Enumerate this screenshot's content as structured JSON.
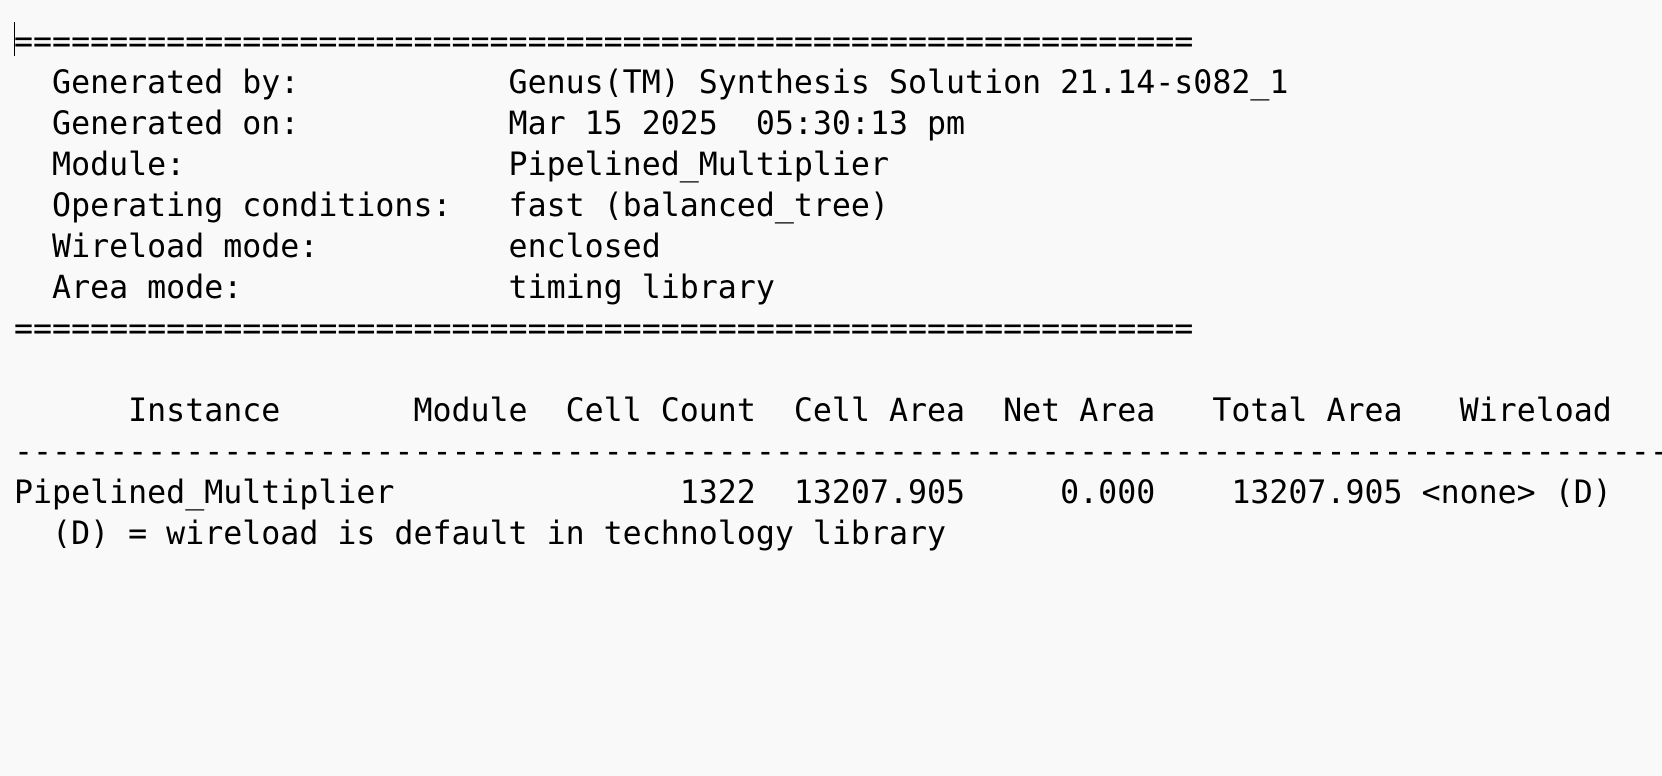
{
  "report": {
    "rule_double": "==============================================================",
    "rule_single": "------------------------------------------------------------------------------------------",
    "header": [
      {
        "label": "Generated by:",
        "value": "Genus(TM) Synthesis Solution 21.14-s082_1"
      },
      {
        "label": "Generated on:",
        "value": "Mar 15 2025  05:30:13 pm"
      },
      {
        "label": "Module:",
        "value": "Pipelined_Multiplier"
      },
      {
        "label": "Operating conditions:",
        "value": "fast (balanced_tree)"
      },
      {
        "label": "Wireload mode:",
        "value": "enclosed"
      },
      {
        "label": "Area mode:",
        "value": "timing library"
      }
    ],
    "columns": [
      "Instance",
      "Module",
      "Cell Count",
      "Cell Area",
      "Net Area",
      "Total Area",
      "Wireload"
    ],
    "rows": [
      {
        "instance": "Pipelined_Multiplier",
        "module": "",
        "cell_count": "1322",
        "cell_area": "13207.905",
        "net_area": "0.000",
        "total_area": "13207.905",
        "wireload": "<none> (D)"
      }
    ],
    "footnote": "(D) = wireload is default in technology library"
  }
}
